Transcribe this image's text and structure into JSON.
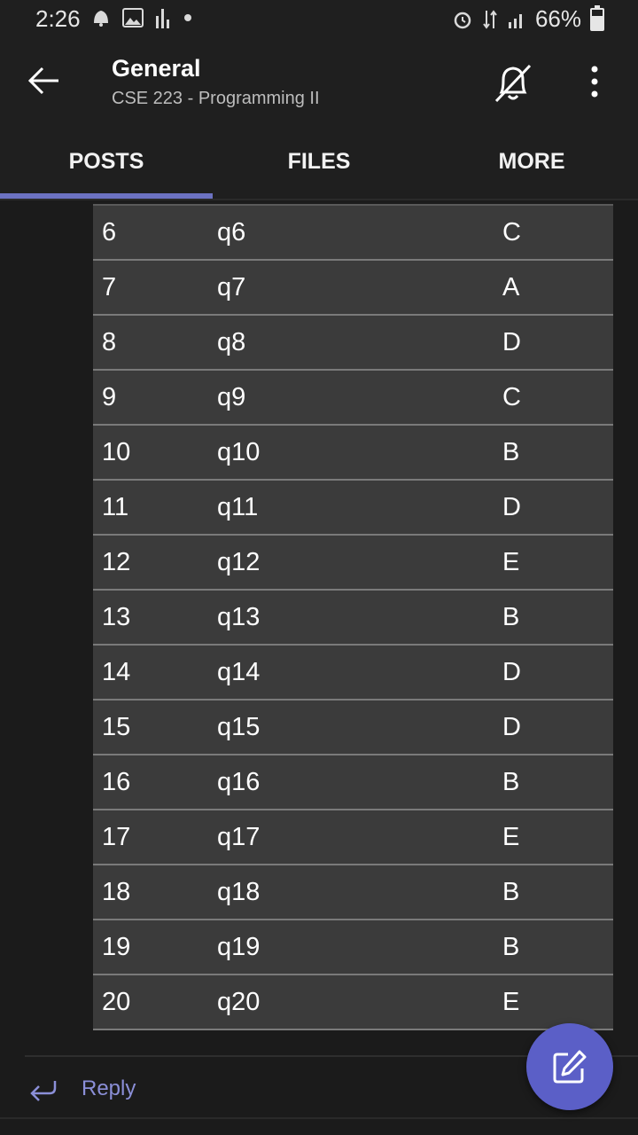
{
  "status_bar": {
    "time": "2:26",
    "battery_text": "66%",
    "battery_level": 0.66,
    "icons_left": [
      "notification-icon",
      "gallery-icon",
      "signal-bars-icon",
      "dot-icon"
    ],
    "icons_right": [
      "alarm-icon",
      "data-arrows-icon",
      "cell-signal-icon",
      "battery-icon"
    ]
  },
  "header": {
    "title": "General",
    "subtitle": "CSE 223 - Programming II",
    "icons": [
      "back-arrow-icon",
      "bell-off-icon",
      "more-vertical-icon"
    ]
  },
  "tabs": [
    {
      "label": "POSTS",
      "active": true
    },
    {
      "label": "FILES",
      "active": false
    },
    {
      "label": "MORE",
      "active": false
    }
  ],
  "table": {
    "rows": [
      {
        "num": "6",
        "q": "q6",
        "ans": "C"
      },
      {
        "num": "7",
        "q": "q7",
        "ans": "A"
      },
      {
        "num": "8",
        "q": "q8",
        "ans": "D"
      },
      {
        "num": "9",
        "q": "q9",
        "ans": "C"
      },
      {
        "num": "10",
        "q": "q10",
        "ans": "B"
      },
      {
        "num": "11",
        "q": "q11",
        "ans": "D"
      },
      {
        "num": "12",
        "q": "q12",
        "ans": "E"
      },
      {
        "num": "13",
        "q": "q13",
        "ans": "B"
      },
      {
        "num": "14",
        "q": "q14",
        "ans": "D"
      },
      {
        "num": "15",
        "q": "q15",
        "ans": "D"
      },
      {
        "num": "16",
        "q": "q16",
        "ans": "B"
      },
      {
        "num": "17",
        "q": "q17",
        "ans": "E"
      },
      {
        "num": "18",
        "q": "q18",
        "ans": "B"
      },
      {
        "num": "19",
        "q": "q19",
        "ans": "B"
      },
      {
        "num": "20",
        "q": "q20",
        "ans": "E"
      }
    ]
  },
  "reply": {
    "label": "Reply",
    "icon": "reply-arrow-icon"
  },
  "fab": {
    "icon": "compose-icon"
  },
  "colors": {
    "accent": "#5b5fc7",
    "tab_indicator": "#6c72c1",
    "reply_text": "#8b8fd8",
    "background": "#1b1b1b",
    "row_bg": "#3b3b3b"
  }
}
